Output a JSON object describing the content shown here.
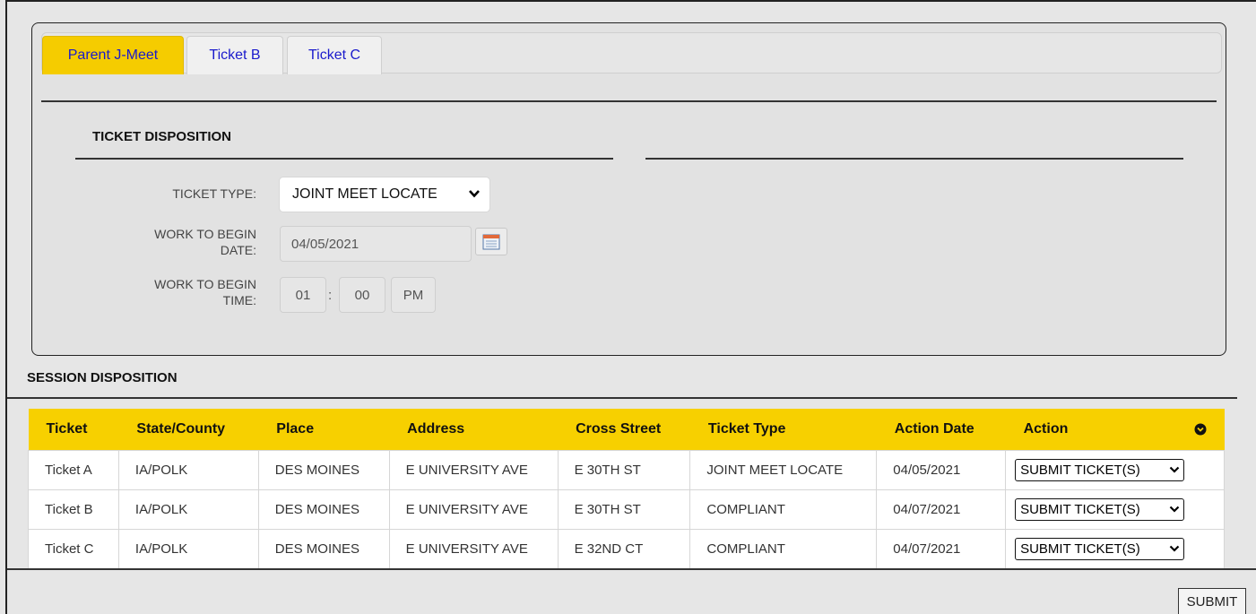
{
  "tabs": [
    {
      "label": "Parent J-Meet",
      "active": true
    },
    {
      "label": "Ticket B",
      "active": false
    },
    {
      "label": "Ticket C",
      "active": false
    }
  ],
  "ticket_disposition": {
    "title": "TICKET DISPOSITION",
    "ticket_type_label": "TICKET TYPE:",
    "ticket_type_value": "JOINT MEET LOCATE",
    "work_date_label": "WORK TO BEGIN DATE:",
    "work_date_value": "04/05/2021",
    "work_time_label": "WORK TO BEGIN TIME:",
    "time_hour": "01",
    "time_separator": ":",
    "time_minute": "00",
    "time_ampm": "PM"
  },
  "session_disposition": {
    "title": "SESSION DISPOSITION",
    "columns": [
      "Ticket",
      "State/County",
      "Place",
      "Address",
      "Cross Street",
      "Ticket Type",
      "Action Date",
      "Action"
    ],
    "rows": [
      {
        "ticket": "Ticket A",
        "state_county": "IA/POLK",
        "place": "DES MOINES",
        "address": "E UNIVERSITY AVE",
        "cross_street": "E 30TH ST",
        "ticket_type": "JOINT MEET LOCATE",
        "action_date": "04/05/2021",
        "action": "SUBMIT TICKET(S)"
      },
      {
        "ticket": "Ticket B",
        "state_county": "IA/POLK",
        "place": "DES MOINES",
        "address": "E UNIVERSITY AVE",
        "cross_street": "E 30TH ST",
        "ticket_type": "COMPLIANT",
        "action_date": "04/07/2021",
        "action": "SUBMIT TICKET(S)"
      },
      {
        "ticket": "Ticket C",
        "state_county": "IA/POLK",
        "place": "DES MOINES",
        "address": "E UNIVERSITY AVE",
        "cross_street": "E 32ND CT",
        "ticket_type": "COMPLIANT",
        "action_date": "04/07/2021",
        "action": "SUBMIT TICKET(S)"
      }
    ]
  },
  "submit_label": "SUBMIT",
  "colors": {
    "accent_yellow": "#f7d000",
    "tab_text": "#1a1acc"
  }
}
